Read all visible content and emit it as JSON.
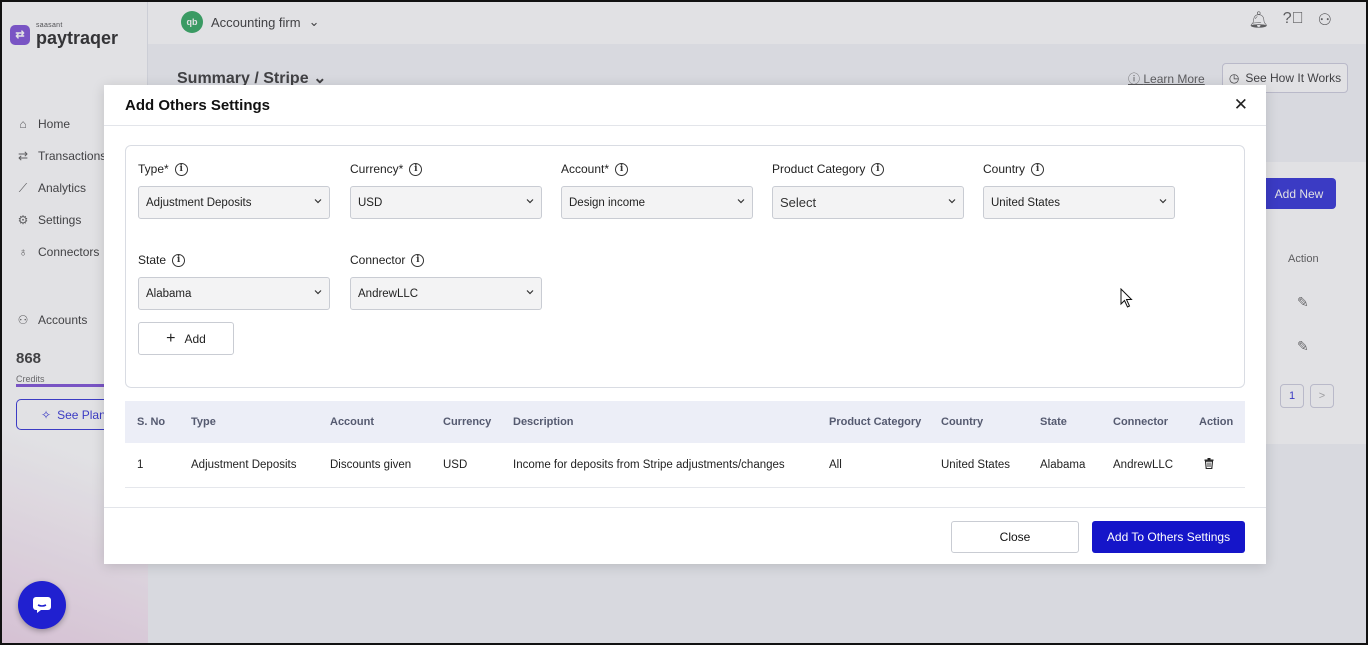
{
  "app": {
    "logo_sub": "saasant",
    "logo_name": "paytraqer",
    "org_name": "Accounting firm",
    "page_title": "Summary / Stripe",
    "learn_more": "Learn More",
    "see_how": "See How It Works",
    "add_new": "Add New",
    "action_header": "Action",
    "pager_current": "1",
    "pager_next": ">",
    "nav": [
      {
        "label": "Home",
        "icon": "home-icon"
      },
      {
        "label": "Transactions",
        "icon": "transfer-icon"
      },
      {
        "label": "Analytics",
        "icon": "chart-icon"
      },
      {
        "label": "Settings",
        "icon": "gear-icon"
      },
      {
        "label": "Connectors",
        "icon": "plug-icon"
      }
    ],
    "accounts_label": "Accounts",
    "credits_value": "868",
    "credits_label": "Credits",
    "see_plans": "See Plans"
  },
  "modal": {
    "title": "Add Others Settings",
    "fields": {
      "type": {
        "label": "Type*",
        "value": "Adjustment Deposits"
      },
      "currency": {
        "label": "Currency*",
        "value": "USD"
      },
      "account": {
        "label": "Account*",
        "value": "Design income"
      },
      "product_category": {
        "label": "Product Category",
        "value": "Select"
      },
      "country": {
        "label": "Country",
        "value": "United States"
      },
      "state": {
        "label": "State",
        "value": "Alabama"
      },
      "connector": {
        "label": "Connector",
        "value": "AndrewLLC"
      }
    },
    "add_button": "Add",
    "table": {
      "headers": [
        "S. No",
        "Type",
        "Account",
        "Currency",
        "Description",
        "Product Category",
        "Country",
        "State",
        "Connector",
        "Action"
      ],
      "rows": [
        [
          "1",
          "Adjustment Deposits",
          "Discounts given",
          "USD",
          "Income for deposits from Stripe adjustments/changes",
          "All",
          "United States",
          "Alabama",
          "AndrewLLC"
        ]
      ]
    },
    "close_button": "Close",
    "submit_button": "Add To Others Settings"
  },
  "colors": {
    "primary": "#1515c9",
    "brand_purple": "#7a4bd6",
    "org_green": "#2aa55a"
  }
}
